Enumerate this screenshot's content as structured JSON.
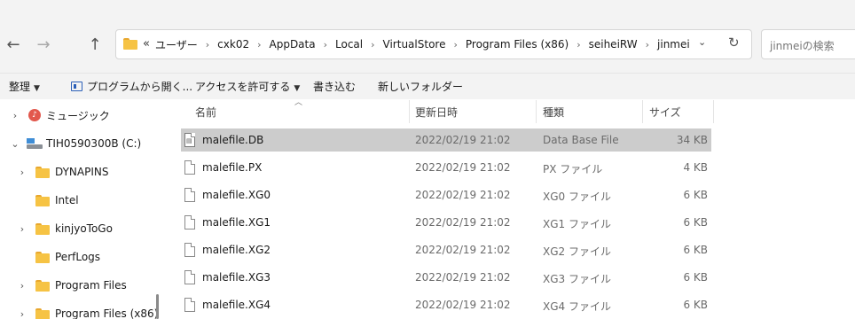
{
  "address": {
    "overflow": "«",
    "crumbs": [
      "ユーザー",
      "cxk02",
      "AppData",
      "Local",
      "VirtualStore",
      "Program Files (x86)",
      "seiheiRW",
      "jinmei"
    ],
    "separator": "›"
  },
  "search": {
    "placeholder": "jinmeiの検索"
  },
  "toolbar": {
    "organize": "整理",
    "open_program": "プログラムから開く...",
    "share": "アクセスを許可する",
    "burn": "書き込む",
    "new_folder": "新しいフォルダー"
  },
  "nav": {
    "items": [
      {
        "label": "ミュージック",
        "kind": "music",
        "chevron": "›"
      },
      {
        "label": "TIH0590300B (C:)",
        "kind": "drive",
        "chevron": "⌄"
      },
      {
        "label": "DYNAPINS",
        "kind": "folder",
        "chevron": "›"
      },
      {
        "label": "Intel",
        "kind": "folder",
        "chevron": ""
      },
      {
        "label": "kinjyoToGo",
        "kind": "folder",
        "chevron": "›"
      },
      {
        "label": "PerfLogs",
        "kind": "folder",
        "chevron": ""
      },
      {
        "label": "Program Files",
        "kind": "folder",
        "chevron": "›"
      },
      {
        "label": "Program Files (x86)",
        "kind": "folder",
        "chevron": "›"
      }
    ]
  },
  "columns": {
    "name": "名前",
    "date": "更新日時",
    "type": "種類",
    "size": "サイズ"
  },
  "files": [
    {
      "name": "malefile.DB",
      "date": "2022/02/19 21:02",
      "type": "Data Base File",
      "size": "34 KB",
      "selected": true,
      "icon": "database-file-icon"
    },
    {
      "name": "malefile.PX",
      "date": "2022/02/19 21:02",
      "type": "PX ファイル",
      "size": "4 KB",
      "selected": false,
      "icon": "file-icon"
    },
    {
      "name": "malefile.XG0",
      "date": "2022/02/19 21:02",
      "type": "XG0 ファイル",
      "size": "6 KB",
      "selected": false,
      "icon": "file-icon"
    },
    {
      "name": "malefile.XG1",
      "date": "2022/02/19 21:02",
      "type": "XG1 ファイル",
      "size": "6 KB",
      "selected": false,
      "icon": "file-icon"
    },
    {
      "name": "malefile.XG2",
      "date": "2022/02/19 21:02",
      "type": "XG2 ファイル",
      "size": "6 KB",
      "selected": false,
      "icon": "file-icon"
    },
    {
      "name": "malefile.XG3",
      "date": "2022/02/19 21:02",
      "type": "XG3 ファイル",
      "size": "6 KB",
      "selected": false,
      "icon": "file-icon"
    },
    {
      "name": "malefile.XG4",
      "date": "2022/02/19 21:02",
      "type": "XG4 ファイル",
      "size": "6 KB",
      "selected": false,
      "icon": "file-icon"
    }
  ],
  "colors": {
    "selection": "#cccccc",
    "folder": "#f6c344",
    "chrome": "#f3f3f3"
  }
}
